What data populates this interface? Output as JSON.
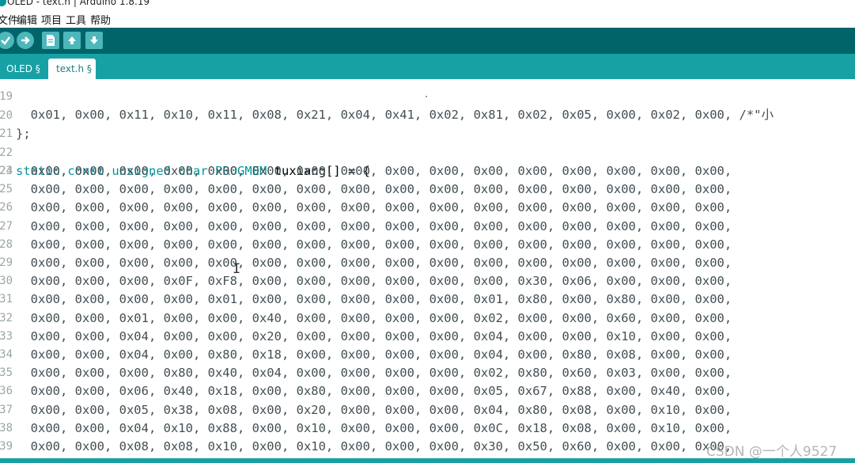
{
  "window": {
    "title": "OLED - text.h | Arduino 1.8.19"
  },
  "menu": [
    "文件",
    "编辑",
    "项目",
    "工具",
    "帮助"
  ],
  "toolbar": {
    "verify": "verify",
    "upload": "upload",
    "new": "new",
    "open": "open",
    "save": "save"
  },
  "tabs": [
    {
      "label": "OLED §"
    },
    {
      "label": "text.h §"
    }
  ],
  "editor": {
    "top_partial": {
      "num": "19",
      "text": "  0x01, 0x00, 0x11, 0x10, 0x11, 0x08, 0x21, 0x04, 0x41, 0x02, 0x81, 0x02, 0x05, 0x00, 0x02, 0x00, /*\"小"
    },
    "l20": {
      "num": "20",
      "text": "};"
    },
    "l21": {
      "num": "21",
      "text": ""
    },
    "l22": {
      "num": "22",
      "kw1": "static",
      "kw2": "const",
      "kw3": "unsigned",
      "kw4": "char",
      "kw5": "PROGMEM",
      "name": "tuxiang[] = {"
    },
    "l23": {
      "num": "23",
      "text": ""
    },
    "rows": [
      {
        "num": "24",
        "text": "  0x00, 0x00, 0x00, 0x00, 0x00, 0x00, 0x00, 0x00, 0x00, 0x00, 0x00, 0x00, 0x00, 0x00, 0x00, 0x00,"
      },
      {
        "num": "25",
        "text": "  0x00, 0x00, 0x00, 0x00, 0x00, 0x00, 0x00, 0x00, 0x00, 0x00, 0x00, 0x00, 0x00, 0x00, 0x00, 0x00,"
      },
      {
        "num": "26",
        "text": "  0x00, 0x00, 0x00, 0x00, 0x00, 0x00, 0x00, 0x00, 0x00, 0x00, 0x00, 0x00, 0x00, 0x00, 0x00, 0x00,"
      },
      {
        "num": "27",
        "text": "  0x00, 0x00, 0x00, 0x00, 0x00, 0x00, 0x00, 0x00, 0x00, 0x00, 0x00, 0x00, 0x00, 0x00, 0x00, 0x00,"
      },
      {
        "num": "28",
        "text": "  0x00, 0x00, 0x00, 0x00, 0x00, 0x00, 0x00, 0x00, 0x00, 0x00, 0x00, 0x00, 0x00, 0x00, 0x00, 0x00,"
      },
      {
        "num": "29",
        "text": "  0x00, 0x00, 0x00, 0x00, 0x00, 0x00, 0x00, 0x00, 0x00, 0x00, 0x00, 0x00, 0x00, 0x00, 0x00, 0x00,"
      },
      {
        "num": "30",
        "text": "  0x00, 0x00, 0x00, 0x0F, 0xF8, 0x00, 0x00, 0x00, 0x00, 0x00, 0x00, 0x30, 0x06, 0x00, 0x00, 0x00,"
      },
      {
        "num": "31",
        "text": "  0x00, 0x00, 0x00, 0x00, 0x01, 0x00, 0x00, 0x00, 0x00, 0x00, 0x01, 0x80, 0x00, 0x80, 0x00, 0x00,"
      },
      {
        "num": "32",
        "text": "  0x00, 0x00, 0x01, 0x00, 0x00, 0x40, 0x00, 0x00, 0x00, 0x00, 0x02, 0x00, 0x00, 0x60, 0x00, 0x00,"
      },
      {
        "num": "33",
        "text": "  0x00, 0x00, 0x04, 0x00, 0x00, 0x20, 0x00, 0x00, 0x00, 0x00, 0x04, 0x00, 0x00, 0x10, 0x00, 0x00,"
      },
      {
        "num": "34",
        "text": "  0x00, 0x00, 0x04, 0x00, 0x80, 0x18, 0x00, 0x00, 0x00, 0x00, 0x04, 0x00, 0x80, 0x08, 0x00, 0x00,"
      },
      {
        "num": "35",
        "text": "  0x00, 0x00, 0x00, 0x80, 0x40, 0x04, 0x00, 0x00, 0x00, 0x00, 0x02, 0x80, 0x60, 0x03, 0x00, 0x00,"
      },
      {
        "num": "36",
        "text": "  0x00, 0x00, 0x06, 0x40, 0x18, 0x00, 0x80, 0x00, 0x00, 0x00, 0x05, 0x67, 0x88, 0x00, 0x40, 0x00,"
      },
      {
        "num": "37",
        "text": "  0x00, 0x00, 0x05, 0x38, 0x08, 0x00, 0x20, 0x00, 0x00, 0x00, 0x04, 0x80, 0x08, 0x00, 0x10, 0x00,"
      },
      {
        "num": "38",
        "text": "  0x00, 0x00, 0x04, 0x10, 0x88, 0x00, 0x10, 0x00, 0x00, 0x00, 0x0C, 0x18, 0x08, 0x00, 0x10, 0x00,"
      },
      {
        "num": "39",
        "text": "  0x00, 0x00, 0x08, 0x08, 0x10, 0x00, 0x10, 0x00, 0x00, 0x00, 0x30, 0x50, 0x60, 0x00, 0x00, 0x00,"
      }
    ]
  },
  "watermark": "CSDN @一个人9527",
  "colors": {
    "toolbar": "#006468",
    "tabbar": "#17a1a5",
    "keyword": "#00979c"
  }
}
